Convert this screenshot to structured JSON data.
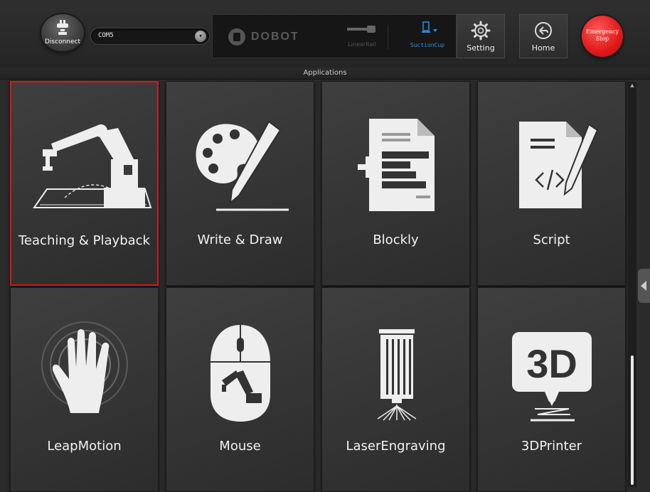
{
  "toolbar": {
    "disconnect_label": "Disconnect",
    "port_value": "COM5",
    "logo_text": "DOBOT",
    "linear_rail_label": "LinearRail",
    "suction_cup_label": "SuctionCup",
    "setting_label": "Setting",
    "home_label": "Home",
    "estop_line1": "Emergency",
    "estop_line2": "Stop"
  },
  "section_title": "Applications",
  "apps": [
    {
      "label": "Teaching & Playback",
      "icon": "robot-arm-icon",
      "selected": true
    },
    {
      "label": "Write & Draw",
      "icon": "palette-pencil-icon"
    },
    {
      "label": "Blockly",
      "icon": "blockly-document-icon"
    },
    {
      "label": "Script",
      "icon": "script-document-icon"
    },
    {
      "label": "LeapMotion",
      "icon": "hand-icon"
    },
    {
      "label": "Mouse",
      "icon": "mouse-icon"
    },
    {
      "label": "LaserEngraving",
      "icon": "laser-icon"
    },
    {
      "label": "3DPrinter",
      "icon": "3d-printer-icon"
    }
  ],
  "colors": {
    "selected_border": "#d41a1a",
    "estop": "#e01919",
    "suction_accent": "#2a8fe6"
  }
}
